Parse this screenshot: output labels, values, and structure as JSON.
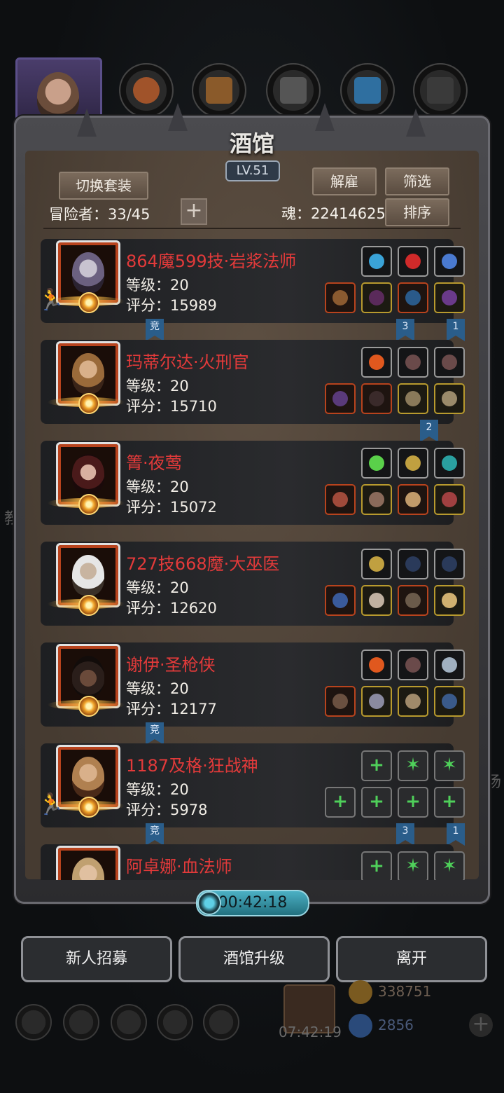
{
  "tavern": {
    "title": "酒馆",
    "level": "LV.51",
    "switch_outfit": "切换套装",
    "dismiss": "解雇",
    "filter": "筛选",
    "sort": "排序",
    "adventurers_label": "冒险者：33/45",
    "soul_label": "魂：22414625"
  },
  "heroes": [
    {
      "name": "864魔599技·岩浆法师",
      "level": "等级：20",
      "score": "评分：15989",
      "top_row": [
        "orb",
        "red-gem",
        "blue-claw"
      ],
      "bottom_row": [
        "staff",
        "robe",
        "bracer",
        "amulet"
      ],
      "flags": [
        "竞",
        "3",
        "1"
      ]
    },
    {
      "name": "玛蒂尔达·火刑官",
      "level": "等级：20",
      "score": "评分：15710",
      "top_row": [
        "fire",
        "feather",
        "feather"
      ],
      "bottom_row": [
        "whip",
        "armor",
        "gauntlet",
        "ring"
      ],
      "flags": [
        "2"
      ]
    },
    {
      "name": "箐·夜莺",
      "level": "等级：20",
      "score": "评分：15072",
      "top_row": [
        "green-flame",
        "lantern",
        "teal-gem"
      ],
      "bottom_row": [
        "sword",
        "helm",
        "charm",
        "heart-pendant"
      ],
      "flags": []
    },
    {
      "name": "727技668魔·大巫医",
      "level": "等级：20",
      "score": "评分：12620",
      "top_row": [
        "gold-mask",
        "blade",
        "blade"
      ],
      "bottom_row": [
        "wand",
        "cloak",
        "tome",
        "ring"
      ],
      "flags": []
    },
    {
      "name": "谢伊·圣枪侠",
      "level": "等级：20",
      "score": "评分：12177",
      "top_row": [
        "fire",
        "feather",
        "crystal"
      ],
      "bottom_row": [
        "gun",
        "armor",
        "spear",
        "ring"
      ],
      "flags": [
        "竞"
      ]
    },
    {
      "name": "1187及格·狂战神",
      "level": "等级：20",
      "score": "评分：5978",
      "top_row": [
        "plus",
        "star",
        "star"
      ],
      "bottom_row": [
        "plus",
        "plus",
        "plus",
        "plus"
      ],
      "flags": [
        "竞",
        "3",
        "1"
      ]
    },
    {
      "name": "阿卓娜·血法师",
      "level": "",
      "score": "",
      "top_row": [
        "plus",
        "star",
        "star"
      ],
      "bottom_row": [],
      "flags": []
    }
  ],
  "timer": "00:42:18",
  "buttons": {
    "recruit": "新人招募",
    "upgrade": "酒馆升级",
    "leave": "离开"
  },
  "background": {
    "gold": "338751",
    "gems": "2856",
    "clock": "07:42:19",
    "left_text": "教",
    "right_text": "场"
  },
  "colors": {
    "hero_name": "#e23a3a",
    "frame": "#4b4b4f",
    "panel": "#4e4238",
    "timer": "#4bb0c4"
  }
}
